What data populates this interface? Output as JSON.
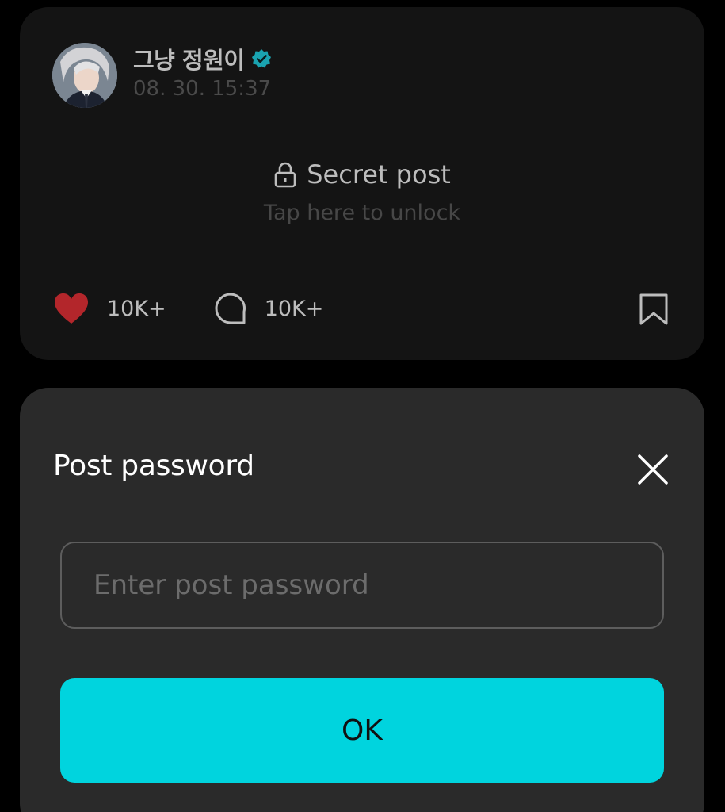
{
  "post": {
    "author_name": "그냥 정원이",
    "verified": true,
    "timestamp": "08. 30. 15:37",
    "secret_title": "Secret post",
    "unlock_hint": "Tap here to unlock",
    "likes_count": "10K+",
    "comments_count": "10K+",
    "liked": true,
    "icons": {
      "verified": "verified-badge-icon",
      "lock": "lock-icon",
      "like": "heart-icon",
      "comment": "comment-bubble-icon",
      "bookmark": "bookmark-icon"
    }
  },
  "password_sheet": {
    "title": "Post password",
    "input_value": "",
    "input_placeholder": "Enter post password",
    "ok_label": "OK",
    "close_icon": "close-icon"
  },
  "colors": {
    "accent": "#00d4de",
    "like": "#b3262b",
    "verified": "#1aa3b0",
    "card_background": "#141414",
    "sheet_background": "#2a2a2a"
  }
}
